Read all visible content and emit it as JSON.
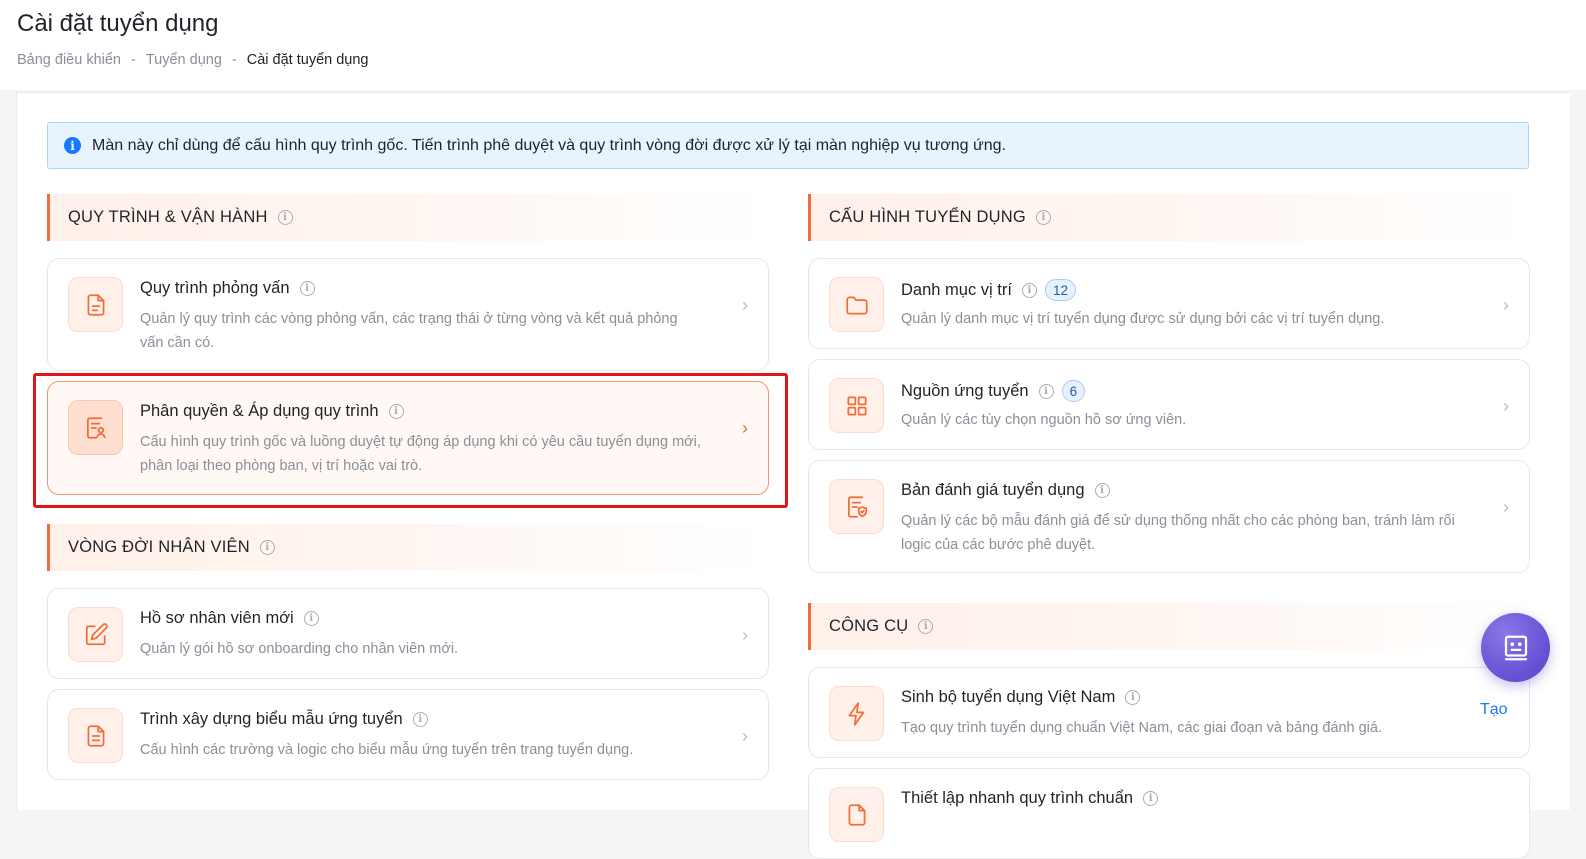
{
  "header": {
    "title": "Cài đặt tuyển dụng",
    "breadcrumb": [
      "Bảng điều khiển",
      "Tuyển dụng",
      "Cài đặt tuyển dụng"
    ],
    "separator": "-"
  },
  "info_bar": {
    "text": "Màn này chỉ dùng để cấu hình quy trình gốc. Tiến trình phê duyệt và quy trình vòng đời được xử lý tại màn nghiệp vụ tương ứng."
  },
  "sections": {
    "process": {
      "title": "QUY TRÌNH & VẬN HÀNH",
      "cards": [
        {
          "title": "Quy trình phỏng vấn",
          "desc_lines": [
            "Quản lý quy trình các vòng phỏng vấn, các trạng thái ở từng vòng và kết quả phỏng",
            "vấn cần có."
          ],
          "icon": "document-icon"
        },
        {
          "title": "Phân quyền & Áp dụng quy trình",
          "desc_lines": [
            "Cấu hình quy trình gốc và luồng duyệt tự động áp dụng khi có yêu cầu tuyển dụng mới,",
            "phân loại theo phòng ban, vị trí hoặc vai trò."
          ],
          "icon": "user-document-icon",
          "active": true
        }
      ]
    },
    "lifecycle": {
      "title": "VÒNG ĐỜI NHÂN VIÊN",
      "cards": [
        {
          "title": "Hồ sơ nhân viên mới",
          "desc_lines": [
            "Quản lý gói hồ sơ onboarding cho nhân viên mới."
          ],
          "icon": "edit-icon"
        },
        {
          "title": "Trình xây dựng biểu mẫu ứng tuyển",
          "desc_lines": [
            "Cấu hình các trường và logic cho biểu mẫu ứng tuyển trên trang tuyển dụng."
          ],
          "icon": "form-icon"
        }
      ]
    },
    "recruit_config": {
      "title": "CẤU HÌNH TUYỂN DỤNG",
      "cards": [
        {
          "title": "Danh mục vị trí",
          "badge": "12",
          "desc_lines": [
            "Quản lý danh mục vị trí tuyển dụng được sử dụng bởi các vị trí tuyển dụng."
          ],
          "icon": "folder-icon"
        },
        {
          "title": "Nguồn ứng tuyển",
          "badge": "6",
          "desc_lines": [
            "Quản lý các tùy chọn nguồn hồ sơ ứng viên."
          ],
          "icon": "grid-icon"
        },
        {
          "title": "Bản đánh giá tuyển dụng",
          "desc_lines": [
            "Quản lý các bộ mẫu đánh giá để sử dụng thống nhất cho các phòng ban, tránh làm rối",
            "logic của các bước phê duyệt."
          ],
          "icon": "shield-document-icon"
        }
      ]
    },
    "tools": {
      "title": "CÔNG CỤ",
      "cards": [
        {
          "title": "Sinh bộ tuyển dụng Việt Nam",
          "desc_lines": [
            "Tạo quy trình tuyển dụng chuẩn Việt Nam, các giai đoạn và bảng đánh giá."
          ],
          "icon": "lightning-icon",
          "action": "Tạo"
        },
        {
          "title": "Thiết lập nhanh quy trình chuẩn",
          "icon": "document-icon"
        }
      ]
    }
  },
  "colors": {
    "accent": "#f26b3a",
    "info_blue": "#1677ff",
    "highlight": "#e0161b",
    "fab": "#6b54d6"
  }
}
